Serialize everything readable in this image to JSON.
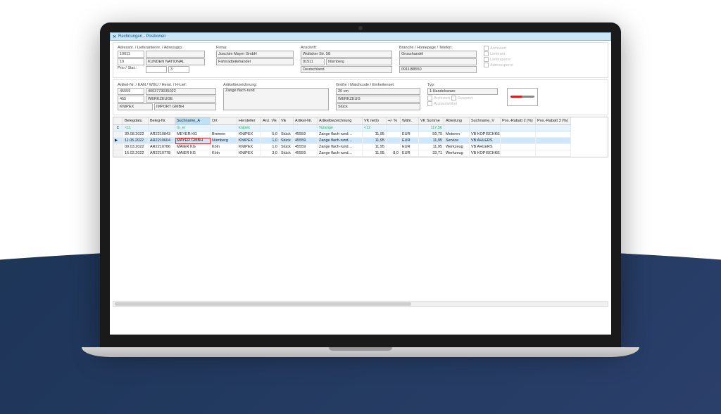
{
  "window": {
    "title": "Rechnungen - Positionen"
  },
  "header_labels": {
    "adressnr": "Adressnr. / Lieferantennr. / Adressgrp:",
    "firma": "Firma:",
    "anschrift": "Anschrift:",
    "branche": "Branche / Homepage / Telefon:",
    "prio": "Prio / Stat.:"
  },
  "address": {
    "nr": "10011",
    "liefnr": "10",
    "gruppe": "KUNDEN NATIONAL",
    "prio": "",
    "stat": "3"
  },
  "firma": {
    "line1": "Joachim Mayer GmbH",
    "line2": "Fahrradteilehandel"
  },
  "anschrift": {
    "street": "Wollaher Str. 58",
    "plz": "91511",
    "ort": "Nürnberg",
    "land": "Deutschland"
  },
  "branche": {
    "br": "Grosshandel",
    "hp": "",
    "tel": "0911/88550"
  },
  "flags": {
    "archiviert": "Archiviert",
    "lieferant": "Lieferant",
    "liefersperre": "Liefersperre",
    "adresssperre": "Adresssperre"
  },
  "article_labels": {
    "artnr": "Artikel-Nr. / EAN / WGU / Herst. / H-Lief:",
    "bez": "Artikelbezeichnung:",
    "groesse": "Größe / Matchcode / Einheitenset:",
    "typ": "Typ:"
  },
  "article": {
    "nr": "45559",
    "ean": " 4003773035022",
    "wgu": "455",
    "wguname": "WERKZEUGE",
    "herst": "KNIPEX",
    "hlief": "IMPORT GMBH",
    "bez": "Zange flach-rund",
    "groesse": "20 cm",
    "match": "WERKZEUG",
    "einh": "Stück",
    "typ": "1:Handelsware"
  },
  "article_flags": {
    "archiviert": "Archiviert",
    "gesperrt": "Gesperrt",
    "auslauf": "Auslaufartikel"
  },
  "columns": [
    "",
    "Belegdatu",
    "Beleg-Nr.",
    "Suchname_A",
    "Ort",
    "Hersteller",
    "Anz. VE",
    "VE",
    "Artikel-Nr.",
    "Artikelbezeichnung",
    "VK netto",
    "+/- %",
    "Währ.",
    "VK Summe",
    "Abteilung",
    "Suchname_V",
    "Pos.-Rabatt 2 (%)",
    "Pos.-Rabatt 3 (%)"
  ],
  "filter": {
    "sigma": "Σ",
    "belegdatu": "<11",
    "suchname": "m_er",
    "hersteller": "knipex",
    "artbez": "%zange",
    "vknetto": "<12",
    "vksum": "117,56"
  },
  "rows": [
    {
      "sel": false,
      "gutter": "",
      "date": "30.08.2022",
      "nr": "AR2210843",
      "such": "MEYER KG",
      "ort": "Bremen",
      "her": "KNIPEX",
      "anz": "5,0",
      "ve": "Stück",
      "art": "45559",
      "bez": "Zange flach-rund…",
      "vk": "11,95",
      "pm": "",
      "w": "EUR",
      "sum": "59,75",
      "abt": "Motoren",
      "sv": "VB KOPISCHKE"
    },
    {
      "sel": true,
      "gutter": "▶",
      "date": "11.05.2022",
      "nr": "AR2210604",
      "such": "MAYER GMBH",
      "ort": "Nürnberg",
      "her": "KNIPEX",
      "anz": "1,0",
      "ve": "Stück",
      "art": "45559",
      "bez": "Zange flach-rund…",
      "vk": "11,95",
      "pm": "",
      "w": "EUR",
      "sum": "11,95",
      "abt": "Service",
      "sv": "VB AHLERS"
    },
    {
      "sel": false,
      "gutter": "",
      "date": "09.03.2022",
      "nr": "AR2210786",
      "such": "MAIER KG",
      "ort": "Köln",
      "her": "KNIPEX",
      "anz": "1,0",
      "ve": "Stück",
      "art": "45559",
      "bez": "Zange flach-rund…",
      "vk": "11,95",
      "pm": "",
      "w": "EUR",
      "sum": "11,95",
      "abt": "Werkzeug",
      "sv": "VB AHLERS"
    },
    {
      "sel": false,
      "gutter": "",
      "date": "16.02.2022",
      "nr": "AR2210778",
      "such": "MAIER KG",
      "ort": "Köln",
      "her": "KNIPEX",
      "anz": "3,0",
      "ve": "Stück",
      "art": "45559",
      "bez": "Zange flach-rund…",
      "vk": "11,95",
      "pm": "8,0",
      "w": "EUR",
      "sum": "33,71",
      "abt": "Werkzeug",
      "sv": "VB KOPISCHKE"
    }
  ]
}
